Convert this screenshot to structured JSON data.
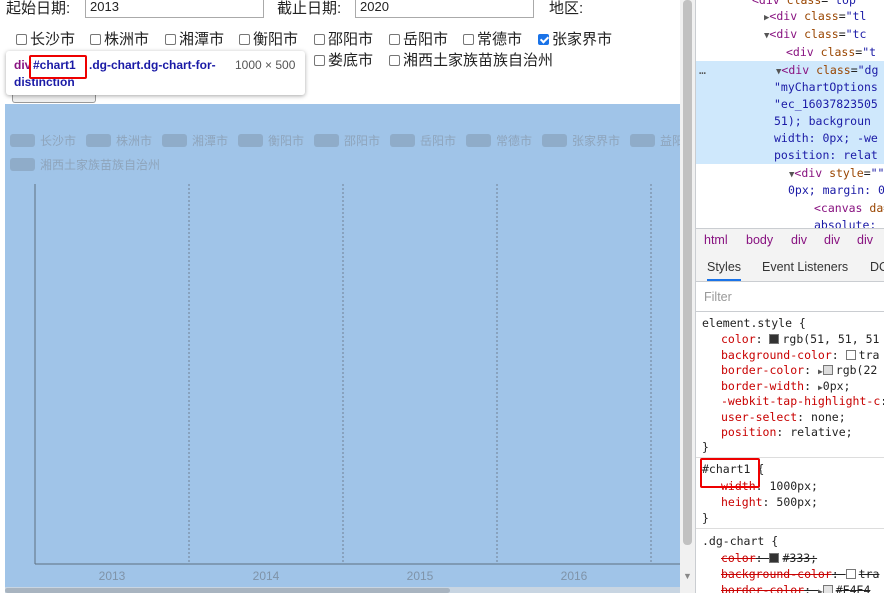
{
  "form": {
    "start_label": "起始日期:",
    "start_value": "2013",
    "end_label": "截止日期:",
    "end_value": "2020",
    "region_label": "地区:",
    "regions_row1": [
      {
        "label": "长沙市",
        "checked": false
      },
      {
        "label": "株洲市",
        "checked": false
      },
      {
        "label": "湘潭市",
        "checked": false
      },
      {
        "label": "衡阳市",
        "checked": false
      },
      {
        "label": "邵阳市",
        "checked": false
      },
      {
        "label": "岳阳市",
        "checked": false
      },
      {
        "label": "常德市",
        "checked": false
      },
      {
        "label": "张家界市",
        "checked": true
      }
    ],
    "regions_row2": [
      {
        "label": "娄底市",
        "checked": false
      },
      {
        "label": "湘西土家族苗族自治州",
        "checked": false
      }
    ]
  },
  "tooltip": {
    "tag": "div",
    "id": "#chart1",
    "classes": ".dg-chart.dg-chart-for-",
    "classes_cont": "distinction",
    "dims": "1000 × 500"
  },
  "chart_data": {
    "type": "line",
    "legend": [
      "长沙市",
      "株洲市",
      "湘潭市",
      "衡阳市",
      "邵阳市",
      "岳阳市",
      "常德市",
      "张家界市",
      "益阳",
      "湘西土家族苗族自治州"
    ],
    "categories": [
      "2013",
      "2014",
      "2015",
      "2016"
    ],
    "series": []
  },
  "devtools": {
    "elements": [
      {
        "tag": "div",
        "attr": "class",
        "val": "top"
      },
      {
        "tag": "div",
        "attr": "class",
        "val": "tl"
      },
      {
        "tag": "div",
        "attr": "class",
        "val": "tc"
      },
      {
        "tag": "div",
        "attr": "class",
        "val": "t"
      },
      {
        "tag": "div",
        "attr": "class",
        "val": "dg"
      },
      {
        "text": "\"myChartOptions"
      },
      {
        "text": "\"ec_16037823505"
      },
      {
        "text": "51); backgroun"
      },
      {
        "text": "width: 0px; -we"
      },
      {
        "text": "position: relat"
      },
      {
        "tag": "div",
        "attr": "style",
        "val": "\""
      },
      {
        "text": "0px; margin: 0"
      },
      {
        "tag": "canvas",
        "attr": "da",
        "val": ""
      },
      {
        "text": "absolute;"
      }
    ],
    "breadcrumbs": [
      "html",
      "body",
      "div",
      "div",
      "div"
    ],
    "tabs": [
      "Styles",
      "Event Listeners",
      "DO"
    ],
    "filter_placeholder": "Filter",
    "element_style_selector": "element.style {",
    "element_style": [
      {
        "prop": "color",
        "val": "rgb(51, 51, 51",
        "swatch": "#333333"
      },
      {
        "prop": "background-color",
        "val": "tra",
        "swatch": "#ffffff"
      },
      {
        "prop": "border-color",
        "val": "rgb(22",
        "swatch": "#dddddd",
        "arrow": true
      },
      {
        "prop": "border-width",
        "val": "0px;",
        "arrow": true
      },
      {
        "prop": "-webkit-tap-highlight-c",
        "val": ""
      },
      {
        "prop": "user-select",
        "val": "none;"
      },
      {
        "prop": "position",
        "val": "relative;"
      }
    ],
    "close_brace": "}",
    "chart1_selector": "#chart1 {",
    "chart1_rules": [
      {
        "prop": "width",
        "val": "1000px;"
      },
      {
        "prop": "height",
        "val": "500px;"
      }
    ],
    "dgchart_selector": ".dg-chart {",
    "dgchart_rules": [
      {
        "prop": "color",
        "val": "#333;",
        "swatch": "#333333"
      },
      {
        "prop": "background-color",
        "val": "tra",
        "swatch": "#ffffff"
      },
      {
        "prop": "border-color",
        "val": "#E4E4",
        "swatch": "#e4e4e4",
        "arrow": true
      }
    ]
  },
  "colors": {
    "highlight": "#a0c4e8",
    "accent": "#1a73e8",
    "annotation": "#e00000"
  }
}
